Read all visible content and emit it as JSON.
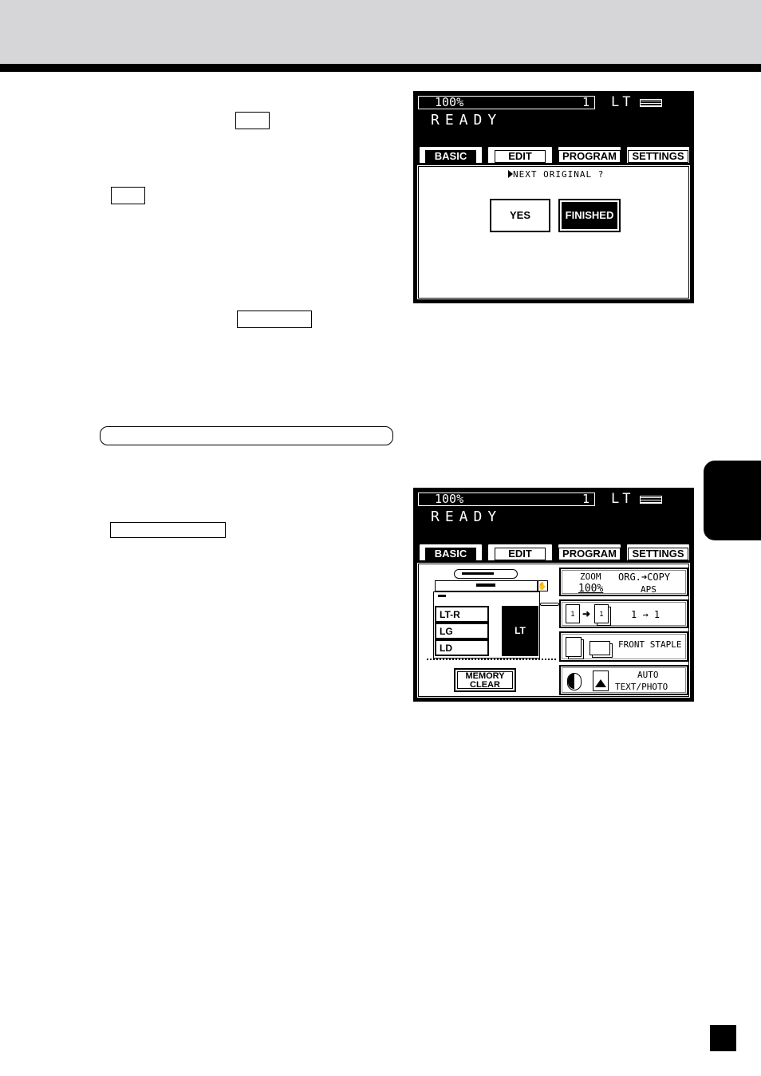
{
  "lcd_top": {
    "zoom": "100%",
    "count": "1",
    "paper_size": "LT",
    "status": "READY",
    "tabs": [
      "BASIC",
      "EDIT",
      "PROGRAM",
      "SETTINGS"
    ],
    "prompt": "NEXT ORIGINAL ?",
    "yes_label": "YES",
    "finished_label": "FINISHED"
  },
  "lcd_bottom": {
    "zoom": "100%",
    "count": "1",
    "paper_size": "LT",
    "status": "READY",
    "tabs": [
      "BASIC",
      "EDIT",
      "PROGRAM",
      "SETTINGS"
    ],
    "trays": [
      "LT-R",
      "LG",
      "LD"
    ],
    "selected_tray": "LT",
    "memory_clear": [
      "MEMORY",
      "CLEAR"
    ],
    "zoom_label": "ZOOM",
    "zoom_value": "100%",
    "org_copy": "ORG.",
    "copy_label": "COPY",
    "aps": "APS",
    "duplex_text": "1 → 1",
    "finisher_text": "FRONT STAPLE",
    "density_auto": "AUTO",
    "mode_text": "TEXT/PHOTO"
  },
  "colors": {
    "band": "#d6d6d8",
    "ink": "#000000",
    "paper": "#ffffff"
  },
  "icons": [
    "play-triangle-icon",
    "copier-icon",
    "hand-icon",
    "duplex-icon",
    "staple-icon",
    "density-icon",
    "photo-icon",
    "paper-icon"
  ]
}
